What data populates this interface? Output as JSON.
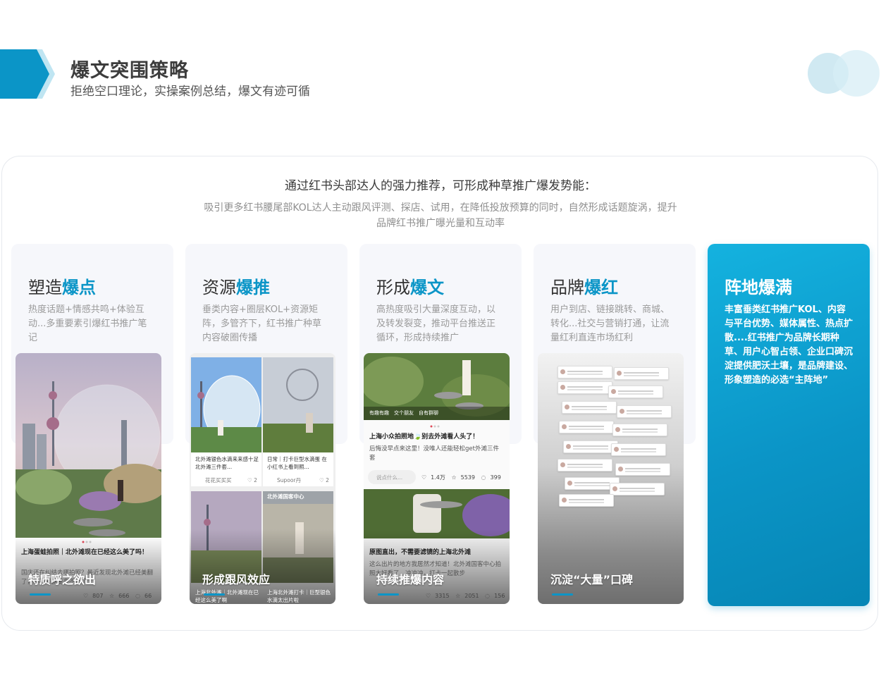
{
  "header": {
    "title": "爆文突围策略",
    "subtitle": "拒绝空口理论，实操案例总结，爆文有迹可循"
  },
  "intro": {
    "lead": "通过红书头部达人的强力推荐，可形成种草推广爆发势能：",
    "desc": "吸引更多红书腰尾部KOL达人主动跟风评测、探店、试用，在降低投放预算的同时，自然形成话题旋涡，提升品牌红书推广曝光量和互动率"
  },
  "cards": [
    {
      "title_plain": "塑造",
      "title_highlight": "爆点",
      "text": "热度话题+情感共鸣+体验互动...多重要素引爆红书推广笔记",
      "caption": "特质呼之欲出"
    },
    {
      "title_plain": "资源",
      "title_highlight": "爆推",
      "text": "垂类内容+圈层KOL+资源矩阵，多管齐下，红书推广种草内容破圈传播",
      "caption": "形成跟风效应"
    },
    {
      "title_plain": "形成",
      "title_highlight": "爆文",
      "text": "高热度吸引大量深度互动，以及转发裂变，推动平台推送正循环，形成持续推广",
      "caption": "持续推爆内容"
    },
    {
      "title_plain": "品牌",
      "title_highlight": "爆红",
      "text": "用户到店、链接跳转、商城、转化...社交与营销打通，让流量红利直连市场红利",
      "caption": "沉淀“大量”口碑"
    }
  ],
  "final_card": {
    "title": "阵地爆满",
    "text": "丰富垂类红书推广KOL、内容与平台优势、媒体属性、热点扩散....红书推广为品牌长期种草、用户心智占领、企业口碑沉淀提供肥沃土壤，是品牌建设、形象塑造的必选“主阵地”"
  },
  "shot1": {
    "post_title": "上海蛋蛙拍照｜北外滩现在已经这么美了吗！",
    "post_body": "国庆还在纠结去哪拍照？最近发现北外滩已经美翻了，再不来就要来不及了",
    "stats": [
      "807",
      "666",
      "66"
    ]
  },
  "shot2": {
    "tiles": [
      {
        "text": "北外滩银色水滴来来感十足 北外滩三件套...",
        "user": "花花买买买",
        "likes": "2"
      },
      {
        "text": "日常｜打卡巨型水滴蛋 在小红书上看到照...",
        "user": "Supoor丹",
        "likes": "2"
      }
    ],
    "sign": "北外滩国客中心",
    "bottom": [
      "上海北外滩｜北外滩现在已经这么美了啊",
      "上海北外滩打卡｜巨型银色水滴太出片啦"
    ]
  },
  "shot3": {
    "top_bar": [
      "有趣有趣",
      "交个朋友",
      "自有群聊"
    ],
    "post_title": "上海小众拍照地🍃别去外滩看人头了！",
    "post_body": "后悔没早点来这里！没唯人还能轻松get外滩三件套",
    "input": "说点什么...",
    "stats": [
      "1.4万",
      "5539",
      "399"
    ],
    "post2_title": "原图直出，不需要滤镜的上海北外滩",
    "post2_body": "这么出片的地方我居然才知道！北外滩国客中心拍照太好看了，冲冲冲，打卡一起散步",
    "stats2": [
      "3315",
      "2051",
      "156"
    ]
  },
  "colors": {
    "accent": "#0b95c7",
    "card_bg": "#f6f7fb"
  }
}
